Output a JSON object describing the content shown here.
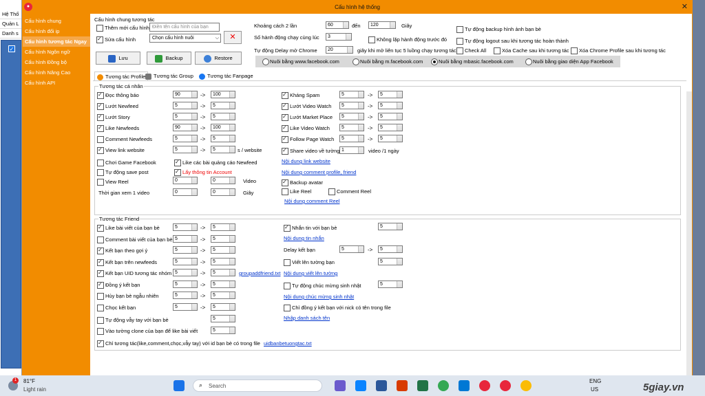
{
  "bg_window": {
    "row1": "Hệ Thố",
    "row2": "Quản L",
    "row3": "Danh s"
  },
  "window": {
    "title": "Cấu hình hệ thống",
    "close": "✕"
  },
  "sidebar": {
    "items": [
      {
        "label": "Cấu hình chung",
        "active": false
      },
      {
        "label": "Cấu hình đổi ip",
        "active": false
      },
      {
        "label": "Cấu hình tương tác Ngay",
        "active": true
      },
      {
        "label": "Cấu hình Ngôn ngữ",
        "active": false
      },
      {
        "label": "Cấu hình Đồng bộ",
        "active": false
      },
      {
        "label": "Cấu hình Nâng Cao",
        "active": false
      },
      {
        "label": "Cấu hình API",
        "active": false
      }
    ]
  },
  "general": {
    "title": "Cấu hình chung tương tác",
    "add_new": "Thêm mới cấu hình",
    "name_placeholder": "Điền tên cấu hình của bạn",
    "edit": "Sửa cấu hình",
    "select_value": "Chọn cấu hình nuôi",
    "save": "Lưu",
    "backup": "Backup",
    "restore": "Restore"
  },
  "timing": {
    "interval_label": "Khoảng cách 2 lần",
    "interval_from": "60",
    "to_label": "đến",
    "interval_to": "120",
    "sec_label": "Giây",
    "concurrent_label": "Số hành động chạy cùng lúc",
    "concurrent": "3",
    "no_repeat": "Không lặp hành động trước đó",
    "delay_label": "Tự động Delay mở Chrome",
    "delay": "20",
    "delay_suffix": "giây khi mở liên tục 5 luồng chạy tương tác",
    "auto_backup": "Tự động backup hình ảnh bạn bè",
    "auto_logout": "Tự động logout sau khi tương tác hoàn thành",
    "check_all": "Check All",
    "clear_cache": "Xóa Cache sau khi tương tác",
    "clear_profile": "Xóa Chrome Profile sau khi tương tác"
  },
  "radios": [
    {
      "label": "Nuôi bằng www.facebook.com",
      "on": false
    },
    {
      "label": "Nuôi bằng m.facebook.com",
      "on": false
    },
    {
      "label": "Nuôi bằng mbasic.facebook.com",
      "on": true
    },
    {
      "label": "Nuôi bằng giao diện App Facebook",
      "on": false
    }
  ],
  "tabs": {
    "profile": "Tương tác Profile",
    "group": "Tương tác Group",
    "fanpage": "Tương tác Fanpage"
  },
  "personal": {
    "title": "Tương tác cá nhân",
    "arrow": "->",
    "left": [
      {
        "label": "Đọc thông báo",
        "on": true,
        "a": "90",
        "b": "100"
      },
      {
        "label": "Lướt Newfeed",
        "on": true,
        "a": "5",
        "b": "5"
      },
      {
        "label": "Lướt Story",
        "on": true,
        "a": "5",
        "b": "5"
      },
      {
        "label": "Like Newfeeds",
        "on": true,
        "a": "90",
        "b": "100"
      },
      {
        "label": "Comment Newfeeds",
        "on": false,
        "a": "5",
        "b": "5"
      },
      {
        "label": "View link website",
        "on": true,
        "a": "5",
        "b": "5",
        "suffix": "s / website"
      }
    ],
    "play_game": "Chơi Game Facebook",
    "like_ads": "Like các bài quảng cáo Newfeed",
    "auto_save": "Tự động save post",
    "get_info": "Lấy thông tin Account",
    "view_reel": "View Reel",
    "reel_a": "0",
    "reel_b": "0",
    "video_label": "Video",
    "watch_time": "Thời gian xem 1 video",
    "watch_a": "0",
    "watch_b": "0",
    "sec_label": "Giây",
    "right": [
      {
        "label": "Kháng Spam",
        "on": true,
        "a": "5",
        "b": "5"
      },
      {
        "label": "Lướt Video Watch",
        "on": true,
        "a": "5",
        "b": "5"
      },
      {
        "label": "Lướt Market Place",
        "on": true,
        "a": "5",
        "b": "5"
      },
      {
        "label": "Like Video Watch",
        "on": true,
        "a": "5",
        "b": "5"
      },
      {
        "label": "Follow Page Watch",
        "on": true,
        "a": "5",
        "b": "5"
      }
    ],
    "share_video": "Share video về tường",
    "share_val": "1",
    "share_suffix": "video /1 ngày",
    "link_website": "Nội dung link website",
    "link_comment_profile": "Nội dung comment profile, friend",
    "backup_avatar": "Backup avatar",
    "like_reel": "Like  Reel",
    "comment_reel": "Comment Reel",
    "link_comment_reel": "Nội dung comment Reel"
  },
  "friend": {
    "title": "Tương tác Friend",
    "arrow": "->",
    "left": [
      {
        "label": "Like bài viết của bạn bè",
        "on": true,
        "a": "5",
        "b": "5"
      },
      {
        "label": "Comment bài viết của bạn bè",
        "on": false,
        "a": "5",
        "b": "5"
      },
      {
        "label": "Kết bạn theo gợi ý",
        "on": true,
        "a": "5",
        "b": "5"
      },
      {
        "label": "Kết bạn trên newfeeds",
        "on": true,
        "a": "5",
        "b": "5"
      },
      {
        "label": "Kết bạn UID tương tác nhóm",
        "on": true,
        "a": "5",
        "b": "5",
        "link": "groupaddfriend.txt"
      },
      {
        "label": "Đồng ý kết bạn",
        "on": true,
        "a": "5",
        "b": "5"
      },
      {
        "label": "Hủy bạn bè ngẫu nhiên",
        "on": false,
        "a": "5",
        "b": "5"
      },
      {
        "label": "Chọc kết bạn",
        "on": false,
        "a": "5",
        "b": "5"
      }
    ],
    "wave": "Tự động vẫy tay với bạn bè",
    "wave_val": "5",
    "clone_wall": "Vào tường clone của bạn để like bài viết",
    "clone_val": "5",
    "only_file": "Chỉ tương tác(like,comment,chọc,vẫy tay) với id bạn bè có trong file",
    "only_file_link": "uidbanbetuongtac.txt",
    "message": "Nhắn tin với bạn bè",
    "message_val": "5",
    "link_message": "Nội dung tin nhắn",
    "delay_friend": "Delay kết bạn",
    "delay_a": "5",
    "delay_b": "5",
    "write_wall": "Viết lên tường bạn",
    "write_val": "5",
    "link_wall": "Nội dung viết lên tường",
    "birthday": "Tự động chúc mừng sinh nhật",
    "birthday_val": "5",
    "link_birthday": "Nội dung chúc mừng sinh nhật",
    "accept_nick": "Chỉ đồng ý kết bạn với nick có tên trong file",
    "link_names": "Nhập danh sách tên"
  },
  "taskbar": {
    "temp": "81°F",
    "weather": "Light rain",
    "search": "Search",
    "lang1": "ENG",
    "lang2": "US",
    "badge": "1",
    "watermark": "5giay.vn"
  }
}
